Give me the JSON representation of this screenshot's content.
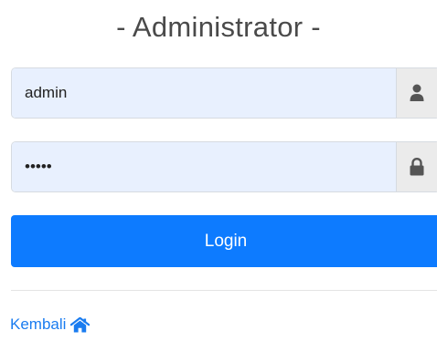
{
  "header": {
    "title": "- Administrator -"
  },
  "form": {
    "username_value": "admin",
    "password_value": "admin",
    "username_icon": "user-icon",
    "password_icon": "lock-icon",
    "login_label": "Login"
  },
  "footer": {
    "back_label": "Kembali",
    "back_icon": "home-icon"
  },
  "colors": {
    "primary": "#0d7bff",
    "link": "#1a7cf0",
    "input_autofill_bg": "#e8f0fe",
    "addon_bg": "#ebebeb",
    "icon": "#555555"
  }
}
